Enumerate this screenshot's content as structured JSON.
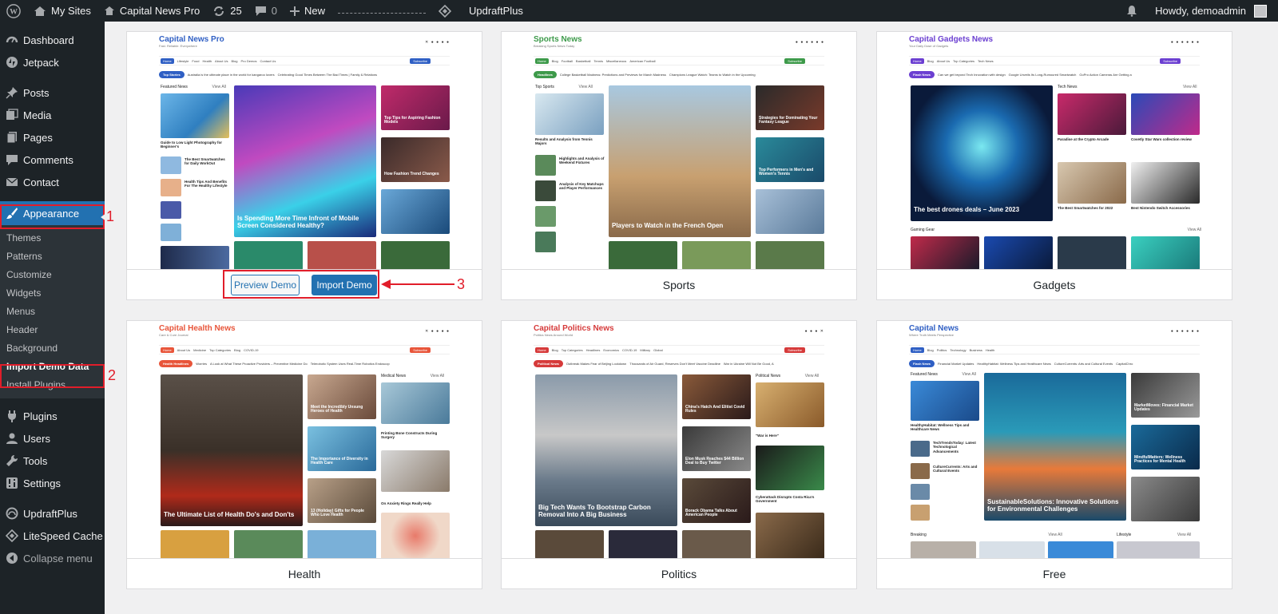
{
  "adminbar": {
    "my_sites": "My Sites",
    "site_name": "Capital News Pro",
    "updates_count": "25",
    "comments_count": "0",
    "new_label": "New",
    "plugin_label": "UpdraftPlus",
    "howdy": "Howdy, demoadmin"
  },
  "sidebar": {
    "items": [
      {
        "label": "Dashboard",
        "icon": "dashboard-icon"
      },
      {
        "label": "Jetpack",
        "icon": "jetpack-icon"
      },
      {
        "label": "Posts",
        "icon": "pin-icon"
      },
      {
        "label": "Media",
        "icon": "media-icon"
      },
      {
        "label": "Pages",
        "icon": "page-icon"
      },
      {
        "label": "Comments",
        "icon": "comment-icon"
      },
      {
        "label": "Contact",
        "icon": "mail-icon"
      },
      {
        "label": "Appearance",
        "icon": "brush-icon"
      },
      {
        "label": "Plugins",
        "icon": "plug-icon"
      },
      {
        "label": "Users",
        "icon": "users-icon"
      },
      {
        "label": "Tools",
        "icon": "wrench-icon"
      },
      {
        "label": "Settings",
        "icon": "settings-icon"
      },
      {
        "label": "UpdraftPlus",
        "icon": "updraft-icon"
      },
      {
        "label": "LiteSpeed Cache",
        "icon": "diamond-icon"
      },
      {
        "label": "Collapse menu",
        "icon": "collapse-icon"
      }
    ],
    "appearance_sub": [
      "Themes",
      "Patterns",
      "Customize",
      "Widgets",
      "Menus",
      "Header",
      "Background",
      "Import Demo Data",
      "Install Plugins"
    ]
  },
  "annotations": [
    "1",
    "2",
    "3"
  ],
  "demos": [
    {
      "name": "Capital News Pro",
      "tagline": "Fast. Reliable. Everywhere",
      "accent": "#2f5fc4",
      "nav": [
        "Home",
        "Lifestyle",
        "Food",
        "Health",
        "About Us",
        "Blog",
        "Pro Demos",
        "Contact Us"
      ],
      "ticker_pill": "Top Stories",
      "ticker": [
        "Australia is the ultimate place in the world for kangaroo lovers",
        "Celebrating Good Times Between The Bad Times | Family & Relations"
      ],
      "section": "Featured News",
      "headline": "Is Spending More Time Infront of Mobile Screen Considered Healthy?",
      "captions": [
        "Guide to Low Light Photography for Beginner's",
        "The Best Smartwatches for Daily WorkOut",
        "Health Tips And Benefits For The Healthy Lifestyle",
        "Top Tips for Aspiring Fashion Models",
        "How Fashion Trend Changes"
      ],
      "footer": "",
      "preview_label": "Preview Demo",
      "import_label": "Import Demo"
    },
    {
      "name": "Sports News",
      "tagline": "Breaking Sports News Today",
      "accent": "#3d9a4a",
      "nav": [
        "Home",
        "Blog",
        "Football",
        "Basketball",
        "Tennis",
        "Miscellaneous",
        "American Football"
      ],
      "ticker_pill": "Headlines",
      "ticker": [
        "College Basketball Madness: Predictions and Previews for March Madness",
        "Champions League Watch: Teams to Watch in the Upcoming"
      ],
      "section": "Top Sports",
      "headline": "Players to Watch in the French Open",
      "captions": [
        "Results and Analysis from Tennis Majors",
        "Highlights and Analysis of Weekend Fixtures",
        "Analysis of Key Matchups and Player Performances",
        "Strategies for Dominating Your Fantasy League",
        "Top Performers in Men's and Women's Tennis"
      ],
      "footer": "Sports"
    },
    {
      "name": "Capital Gadgets News",
      "tagline": "Your Daily Dose of Gadgets",
      "accent": "#6b3fd1",
      "nav": [
        "Home",
        "Blog",
        "About Us",
        "Top Categories",
        "Tech News"
      ],
      "ticker_pill": "Flash News",
      "ticker": [
        "Can we get beyond Tech Innovation with design",
        "Google Unveils Its Long-Rumoured Smartwatch",
        "GoPro Action Cameras Are Getting a"
      ],
      "section": "Tech News",
      "headline": "The best drones deals – June 2023",
      "captions": [
        "Paradise at the Crypto Arcade",
        "Covetly Star Wars collection review",
        "The Best Smartwatches for 2022",
        "Best Nintendo Switch Accessories"
      ],
      "section2": "Gaming Gear",
      "footer": "Gadgets"
    },
    {
      "name": "Capital Health News",
      "tagline": "Care & Cure Journal",
      "accent": "#e8553a",
      "nav": [
        "Home",
        "About Us",
        "Medicine",
        "Top Categories",
        "Blog",
        "COVID-19"
      ],
      "ticker_pill": "Health Headlines",
      "ticker": [
        "Worries",
        "A Look at What These Proactive Providers – Preventive Medicine Do",
        "Telerobotic System Uses Real-Time Robotics Endoscop"
      ],
      "section": "Medical News",
      "headline": "The Ultimate List of Health Do's and Don'ts",
      "captions": [
        "Meet the Incredibly Unsung Heroes of Health",
        "The Importance of Diversity in Health Care",
        "13 (Holiday) Gifts for People Who Love Health",
        "Printing Bone Constructs During Surgery",
        "On Anxiety Rings Really Help"
      ],
      "footer": "Health"
    },
    {
      "name": "Capital Politics News",
      "tagline": "Politics News Around World",
      "accent": "#d63a3a",
      "nav": [
        "Home",
        "Blog",
        "Top Categories",
        "Headlines",
        "Economics",
        "COVID-19",
        "Military",
        "Global"
      ],
      "ticker_pill": "Political News",
      "ticker": [
        "Outbreak Makes Fear of Beijing Lockdown",
        "Thousands of Air Guard, Reserves Don't Meet Vaccine Deadline",
        "War in Ukraine Will Not Be Good, A"
      ],
      "section": "Political News",
      "headline": "Big Tech Wants To Bootstrap Carbon Removal Into A Big Business",
      "captions": [
        "China's Hatch And Elitist Covid Rules",
        "Elon Musk Reaches $44 Billion Deal to Buy Twitter",
        "Borack Obama Talks About American People",
        "\"War is Here\"",
        "Cyberattack Disrupts Costa Rica's Government"
      ],
      "footer": "Politics"
    },
    {
      "name": "Capital News",
      "tagline": "Where Truth Meets Perspective",
      "accent": "#2f5fc4",
      "nav": [
        "Home",
        "Blog",
        "Politics",
        "Technology",
        "Business",
        "Health"
      ],
      "ticker_pill": "Flash News",
      "ticker": [
        "Financial Market Updates",
        "HealthyHabitat: Wellness Tips and Healthcare News",
        "CultureCurrents: Arts and Cultural Events",
        "CapitalChro"
      ],
      "section": "Featured News",
      "headline": "SustainableSolutions: Innovative Solutions for Environmental Challenges",
      "captions": [
        "HealthyHabitat: Wellness Tips and Healthcare News",
        "TechTrendsToday: Latest Technological Advancements",
        "CultureCurrents: Arts and Cultural Events",
        "MarketMoves: Financial Market Updates",
        "MindfulMatters: Wellness Practices for Mental Health"
      ],
      "section2": "Breaking",
      "section3": "Lifestyle",
      "footer": "Free"
    }
  ],
  "view_all": "View All",
  "subscribe": "Subscribe"
}
